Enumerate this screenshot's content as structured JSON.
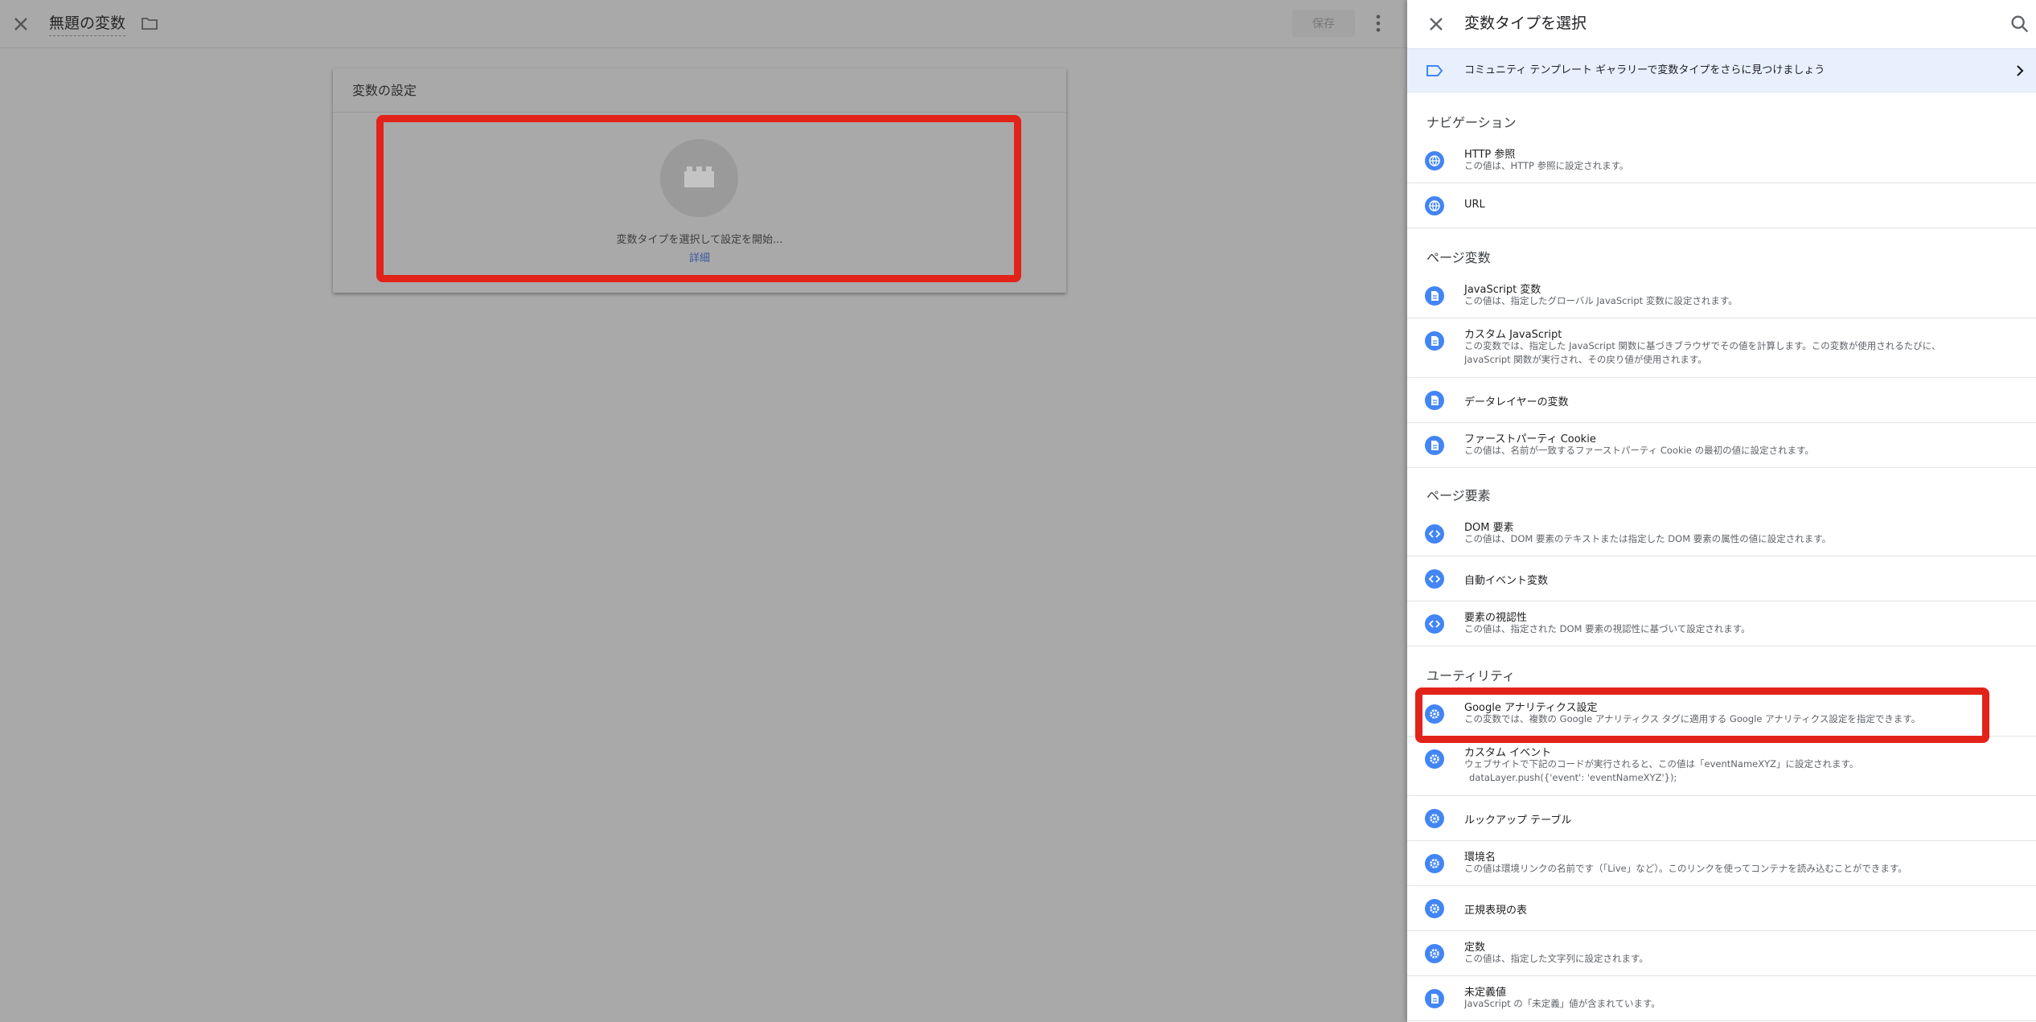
{
  "editor": {
    "title": "無題の変数",
    "save_label": "保存",
    "card_title": "変数の設定",
    "prompt": "変数タイプを選択して設定を開始...",
    "details_link": "詳細"
  },
  "panel": {
    "title": "変数タイプを選択",
    "banner": "コミュニティ テンプレート ギャラリーで変数タイプをさらに見つけましょう",
    "sections": [
      {
        "title": "ナビゲーション",
        "items": [
          {
            "name": "HTTP 参照",
            "desc": [
              "この値は、HTTP 参照に設定されます。"
            ],
            "icon": "globe-icon"
          },
          {
            "name": "URL",
            "desc": [],
            "icon": "globe-icon"
          }
        ]
      },
      {
        "title": "ページ変数",
        "items": [
          {
            "name": "JavaScript 変数",
            "desc": [
              "この値は、指定したグローバル JavaScript 変数に設定されます。"
            ],
            "icon": "document-icon"
          },
          {
            "name": "カスタム JavaScript",
            "desc": [
              "この変数では、指定した JavaScript 関数に基づきブラウザでその値を計算します。この変数が使用されるたびに、",
              "JavaScript 関数が実行され、その戻り値が使用されます。"
            ],
            "icon": "document-icon"
          },
          {
            "name": "データレイヤーの変数",
            "desc": [],
            "icon": "document-icon"
          },
          {
            "name": "ファーストパーティ Cookie",
            "desc": [
              "この値は、名前が一致するファーストパーティ Cookie の最初の値に設定されます。"
            ],
            "icon": "document-icon"
          }
        ]
      },
      {
        "title": "ページ要素",
        "items": [
          {
            "name": "DOM 要素",
            "desc": [
              "この値は、DOM 要素のテキストまたは指定した DOM 要素の属性の値に設定されます。"
            ],
            "icon": "code-icon"
          },
          {
            "name": "自動イベント変数",
            "desc": [],
            "icon": "code-icon"
          },
          {
            "name": "要素の視認性",
            "desc": [
              "この値は、指定された DOM 要素の視認性に基づいて設定されます。"
            ],
            "icon": "code-icon"
          }
        ]
      },
      {
        "title": "ユーティリティ",
        "items": [
          {
            "name": "Google アナリティクス設定",
            "desc": [
              "この変数では、複数の Google アナリティクス タグに適用する Google アナリティクス設定を指定できます。"
            ],
            "icon": "gear-icon"
          },
          {
            "name": "カスタム イベント",
            "desc": [
              "ウェブサイトで下記のコードが実行されると、この値は「eventNameXYZ」に設定されます。",
              "dataLayer.push({'event': 'eventNameXYZ'});"
            ],
            "icon": "gear-icon"
          },
          {
            "name": "ルックアップ テーブル",
            "desc": [],
            "icon": "gear-icon"
          },
          {
            "name": "環境名",
            "desc": [
              "この値は環境リンクの名前です（「Live」など）。このリンクを使ってコンテナを読み込むことができます。"
            ],
            "icon": "gear-icon"
          },
          {
            "name": "正規表現の表",
            "desc": [],
            "icon": "gear-icon"
          },
          {
            "name": "定数",
            "desc": [
              "この値は、指定した文字列に設定されます。"
            ],
            "icon": "gear-icon"
          },
          {
            "name": "未定義値",
            "desc": [
              "JavaScript の「未定義」値が含まれています。"
            ],
            "icon": "gear-icon"
          }
        ]
      }
    ]
  },
  "colors": {
    "accent": "#4285f4",
    "highlight": "#e2231a",
    "banner_bg": "#e8f0fe",
    "overlay": "#a9a9a9"
  }
}
